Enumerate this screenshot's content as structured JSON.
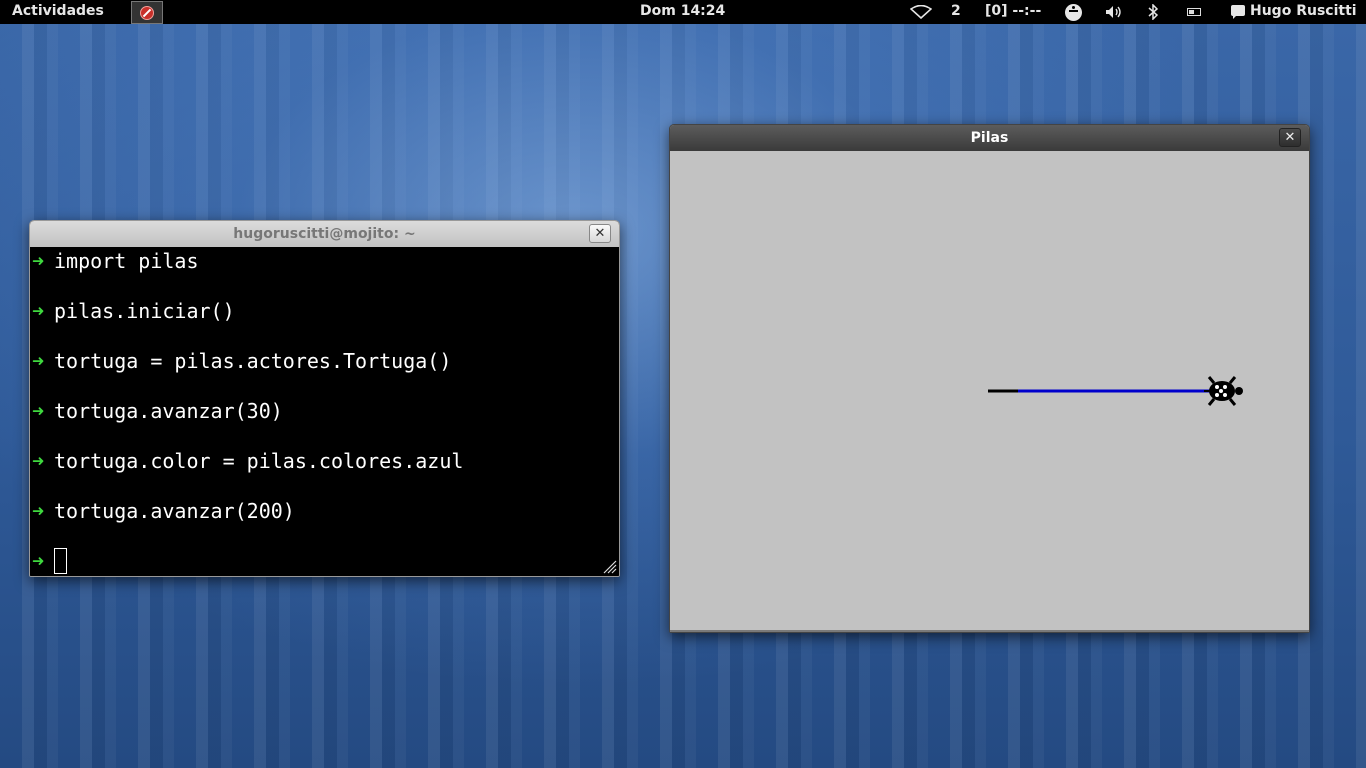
{
  "topbar": {
    "activities": "Actividades",
    "clock": "Dom 14:24",
    "network_count": "2",
    "battery_text": "[0] --:--",
    "user_name": "Hugo Ruscitti"
  },
  "terminal": {
    "title": "hugoruscitti@mojito: ~",
    "close_label": "✕",
    "prompt_symbol": "➜",
    "lines": [
      "import pilas",
      "pilas.iniciar()",
      "tortuga = pilas.actores.Tortuga()",
      "tortuga.avanzar(30)",
      "tortuga.color = pilas.colores.azul",
      "tortuga.avanzar(200)"
    ]
  },
  "pilas_window": {
    "title": "Pilas",
    "close_label": "✕",
    "line_colors": {
      "first": "#000000",
      "second": "#0000cc"
    }
  }
}
